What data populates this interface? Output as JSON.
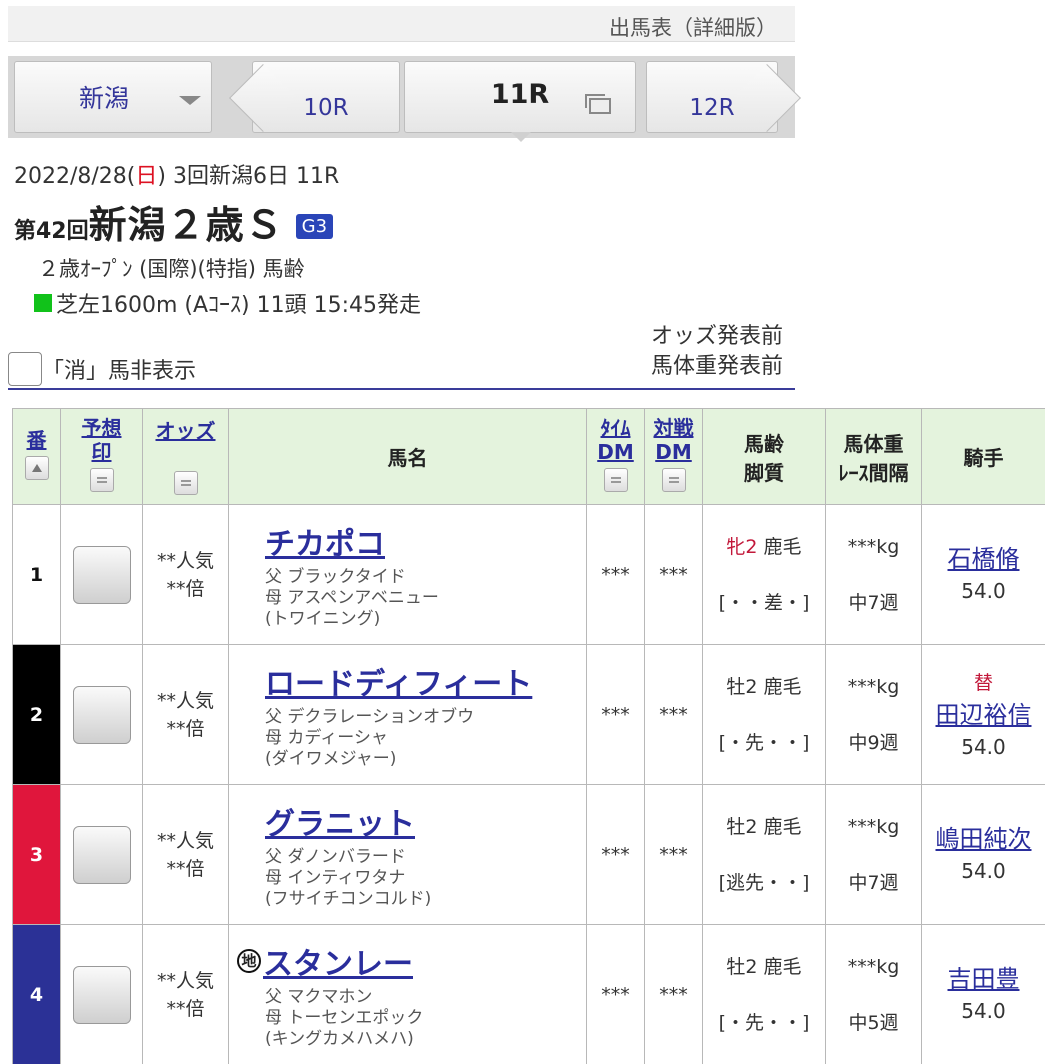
{
  "page_title": "出馬表（詳細版）",
  "nav": {
    "venue": "新潟",
    "prev_race": "10R",
    "current_race": "11R",
    "next_race": "12R"
  },
  "race": {
    "date_pre": "2022/8/28(",
    "date_day": "日",
    "date_post": ") 3回新潟6日 11R",
    "kai": "第42回",
    "name": "新潟２歳Ｓ",
    "grade": "G3",
    "conditions": "２歳ｵｰﾌﾟﾝ (国際)(特指) 馬齢",
    "course": "芝左1600m (Aｺｰｽ) 11頭 15:45発走"
  },
  "status": {
    "odds": "オッズ発表前",
    "weight": "馬体重発表前"
  },
  "hide_toggle_label": "「消」馬非表示",
  "headers": {
    "num": "番",
    "mark_1": "予想",
    "mark_2": "印",
    "odds": "オッズ",
    "name": "馬名",
    "time_dm_1": "ﾀｲﾑ",
    "time_dm_2": "DM",
    "match_dm_1": "対戦",
    "match_dm_2": "DM",
    "age_1": "馬齢",
    "age_2": "脚質",
    "weight_1": "馬体重",
    "weight_2": "ﾚｰｽ間隔",
    "jockey": "騎手"
  },
  "colors": {
    "frame_1": "#ffffff",
    "frame_2": "#000000",
    "frame_3": "#e0163c",
    "frame_4": "#2b3196",
    "accent": "#2a2e9c",
    "header_bg": "#e4f3dd"
  },
  "entries": [
    {
      "num": "1",
      "odds_pop": "**人気",
      "odds_val": "**倍",
      "local_mark": "",
      "name": "チカポコ",
      "sire": "父 ブラックタイド",
      "dam": "母 アスペンアベニュー",
      "damsire": "(トワイニング)",
      "time_dm": "***",
      "match_dm": "***",
      "sex_age": "牝2",
      "coat": " 鹿毛",
      "style": "[・・差・]",
      "weight": "***kg",
      "interval": "中7週",
      "jockey_change": "",
      "jockey": "石橋脩",
      "impost": "54.0"
    },
    {
      "num": "2",
      "odds_pop": "**人気",
      "odds_val": "**倍",
      "local_mark": "",
      "name": "ロードディフィート",
      "sire": "父 デクラレーションオブウ",
      "dam": "母 カディーシャ",
      "damsire": "(ダイワメジャー)",
      "time_dm": "***",
      "match_dm": "***",
      "sex_age": "牡2",
      "coat": " 鹿毛",
      "style": "[・先・・]",
      "weight": "***kg",
      "interval": "中9週",
      "jockey_change": "替",
      "jockey": "田辺裕信",
      "impost": "54.0"
    },
    {
      "num": "3",
      "odds_pop": "**人気",
      "odds_val": "**倍",
      "local_mark": "",
      "name": "グラニット",
      "sire": "父 ダノンバラード",
      "dam": "母 インティワタナ",
      "damsire": "(フサイチコンコルド)",
      "time_dm": "***",
      "match_dm": "***",
      "sex_age": "牡2",
      "coat": " 鹿毛",
      "style": "[逃先・・]",
      "weight": "***kg",
      "interval": "中7週",
      "jockey_change": "",
      "jockey": "嶋田純次",
      "impost": "54.0"
    },
    {
      "num": "4",
      "odds_pop": "**人気",
      "odds_val": "**倍",
      "local_mark": "地",
      "name": "スタンレー",
      "sire": "父 マクマホン",
      "dam": "母 トーセンエポック",
      "damsire": "(キングカメハメハ)",
      "time_dm": "***",
      "match_dm": "***",
      "sex_age": "牡2",
      "coat": " 鹿毛",
      "style": "[・先・・]",
      "weight": "***kg",
      "interval": "中5週",
      "jockey_change": "",
      "jockey": "吉田豊",
      "impost": "54.0"
    }
  ]
}
